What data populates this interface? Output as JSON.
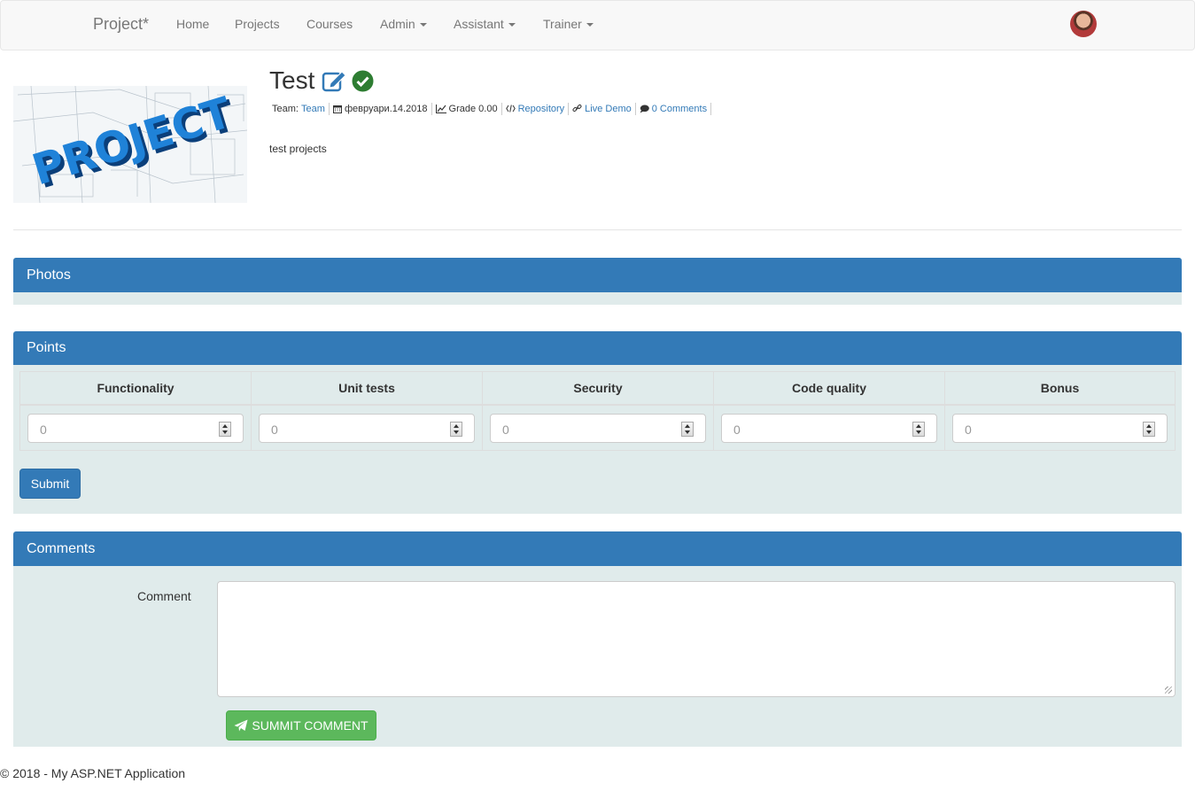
{
  "navbar": {
    "brand": "Project*",
    "items": [
      {
        "label": "Home"
      },
      {
        "label": "Projects"
      },
      {
        "label": "Courses"
      },
      {
        "label": "Admin"
      },
      {
        "label": "Assistant"
      },
      {
        "label": "Trainer"
      }
    ]
  },
  "project": {
    "title": "Test",
    "meta": {
      "team_label": "Team:",
      "team_link": "Team",
      "date": "февруари.14.2018",
      "grade": "Grade 0.00",
      "repository": "Repository",
      "live_demo": "Live Demo",
      "comments": "0 Comments"
    },
    "description": "test projects"
  },
  "photos_panel": {
    "title": "Photos"
  },
  "points_panel": {
    "title": "Points",
    "columns": [
      {
        "header": "Functionality",
        "value": "0"
      },
      {
        "header": "Unit tests",
        "value": "0"
      },
      {
        "header": "Security",
        "value": "0"
      },
      {
        "header": "Code quality",
        "value": "0"
      },
      {
        "header": "Bonus",
        "value": "0"
      }
    ],
    "submit_label": "Submit"
  },
  "comments_panel": {
    "title": "Comments",
    "comment_label": "Comment",
    "comment_value": "",
    "submit_label": "SUMMIT COMMENT"
  },
  "footer": {
    "text": "© 2018 - My ASP.NET Application"
  },
  "colors": {
    "primary": "#337ab7",
    "success": "#5cb85c",
    "panel_bg": "#e0ebeb",
    "check": "#2e7d32"
  }
}
